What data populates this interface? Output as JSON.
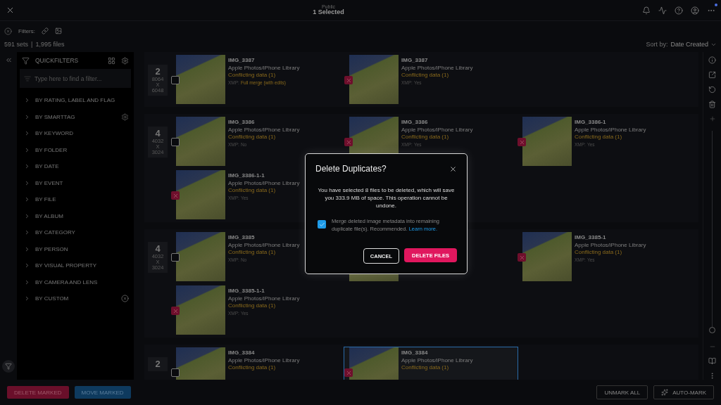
{
  "top_bar": {
    "context": "Public",
    "title": "1 Selected",
    "update_dot": true
  },
  "filters": {
    "label": "Filters:"
  },
  "summary": {
    "sets": "591 sets",
    "separator": "|",
    "files": "1,995 files"
  },
  "sort": {
    "label": "Sort by:",
    "value": "Date Created"
  },
  "sidebar": {
    "title": "QUICKFILTERS",
    "search": {
      "placeholder": "Type here to find a filter..."
    },
    "items": [
      {
        "label": "BY RATING, LABEL AND FLAG",
        "expanded": false,
        "kind": "plain"
      },
      {
        "label": "BY SMARTTAG",
        "expanded": false,
        "kind": "settings"
      },
      {
        "label": "BY KEYWORD",
        "expanded": false,
        "kind": "plain"
      },
      {
        "label": "BY FOLDER",
        "expanded": false,
        "kind": "plain"
      },
      {
        "label": "BY DATE",
        "expanded": false,
        "kind": "plain"
      },
      {
        "label": "BY EVENT",
        "expanded": false,
        "kind": "plain"
      },
      {
        "label": "BY FILE",
        "expanded": false,
        "kind": "plain"
      },
      {
        "label": "BY ALBUM",
        "expanded": false,
        "kind": "plain"
      },
      {
        "label": "BY CATEGORY",
        "expanded": false,
        "kind": "plain"
      },
      {
        "label": "BY PERSON",
        "expanded": false,
        "kind": "plain"
      },
      {
        "label": "BY VISUAL PROPERTY",
        "expanded": false,
        "kind": "plain"
      },
      {
        "label": "BY CAMERA AND LENS",
        "expanded": false,
        "kind": "plain"
      },
      {
        "label": "BY CUSTOM",
        "expanded": false,
        "kind": "remove"
      }
    ]
  },
  "sets": [
    {
      "count": "2",
      "dims": [
        "8064",
        "X",
        "6048"
      ],
      "items": [
        {
          "kind": "file",
          "name": "IMG_3387",
          "source": "Apple Photos/iPhone Library",
          "conflict": "Conflicting data (1)",
          "xmp_label": "XMP:",
          "xmp": "Full merge (with edits)",
          "xmp_highlight": true,
          "marked": false,
          "selected": false
        },
        {
          "kind": "file",
          "name": "IMG_3387",
          "source": "Apple Photos/iPhone Library",
          "conflict": "Conflicting data (1)",
          "xmp_label": "XMP:",
          "xmp": "Yes",
          "xmp_highlight": false,
          "marked": true,
          "selected": false
        }
      ]
    },
    {
      "count": "4",
      "dims": [
        "4032",
        "X",
        "3024"
      ],
      "items": [
        {
          "kind": "file",
          "name": "IMG_3386",
          "source": "Apple Photos/iPhone Library",
          "conflict": "Conflicting data (1)",
          "xmp_label": "XMP:",
          "xmp": "No",
          "xmp_highlight": false,
          "marked": false,
          "selected": false
        },
        {
          "kind": "file",
          "name": "IMG_3386",
          "source": "Apple Photos/iPhone Library",
          "conflict": "Conflicting data (1)",
          "xmp_label": "XMP:",
          "xmp": "Yes",
          "xmp_highlight": false,
          "marked": true,
          "selected": false
        },
        {
          "kind": "file",
          "name": "IMG_3386-1",
          "source": "Apple Photos/iPhone Library",
          "conflict": "Conflicting data (1)",
          "xmp_label": "XMP:",
          "xmp": "Yes",
          "xmp_highlight": false,
          "marked": true,
          "selected": false
        },
        {
          "kind": "file",
          "name": "IMG_3386-1-1",
          "source": "Apple Photos/iPhone Library",
          "conflict": "Conflicting data (1)",
          "xmp_label": "XMP:",
          "xmp": "Yes",
          "xmp_highlight": false,
          "marked": true,
          "selected": false
        }
      ]
    },
    {
      "count": "4",
      "dims": [
        "4032",
        "X",
        "3024"
      ],
      "items": [
        {
          "kind": "file",
          "name": "IMG_3385",
          "source": "Apple Photos/iPhone Library",
          "conflict": "Conflicting data (1)",
          "xmp_label": "XMP:",
          "xmp": "No",
          "xmp_highlight": false,
          "marked": false,
          "selected": false
        },
        {
          "kind": "covered"
        },
        {
          "kind": "file",
          "name": "IMG_3385-1",
          "source": "Apple Photos/iPhone Library",
          "conflict": "Conflicting data (1)",
          "xmp_label": "XMP:",
          "xmp": "Yes",
          "xmp_highlight": false,
          "marked": true,
          "selected": false
        },
        {
          "kind": "file",
          "name": "IMG_3385-1-1",
          "source": "Apple Photos/iPhone Library",
          "conflict": "Conflicting data (1)",
          "xmp_label": "XMP:",
          "xmp": "Yes",
          "xmp_highlight": false,
          "marked": true,
          "selected": false
        }
      ]
    },
    {
      "count": "2",
      "items": [
        {
          "kind": "file",
          "name": "IMG_3384",
          "source": "Apple Photos/iPhone Library",
          "conflict": "Conflicting data (1)",
          "marked": false,
          "selected": false
        },
        {
          "kind": "file",
          "name": "IMG_3384",
          "source": "Apple Photos/iPhone Library",
          "conflict": "Conflicting data (1)",
          "marked": true,
          "selected": true
        }
      ]
    }
  ],
  "zoom_slider": {
    "level": 0
  },
  "bottom_left": [
    {
      "label": "DELETE MARKED",
      "kind": "danger"
    },
    {
      "label": "MOVE MARKED",
      "kind": "primary"
    }
  ],
  "bottom_right": [
    {
      "label": "UNMARK ALL",
      "kind": "outline"
    },
    {
      "label": "AUTO-MARK",
      "kind": "outline_icon"
    }
  ],
  "dialog": {
    "title": "Delete Duplicates?",
    "message": "You have selected 8 files to be deleted, which will save you 333.9 MB of space. This operation cannot be undone.",
    "merge": {
      "checked": true,
      "text": "Merge deleted image metadata into remaining duplicate file(s). Recommended.",
      "link": "Learn more."
    },
    "buttons": [
      {
        "label": "CANCEL",
        "kind": "secondary"
      },
      {
        "label": "DELETE FILES",
        "kind": "danger"
      }
    ]
  }
}
